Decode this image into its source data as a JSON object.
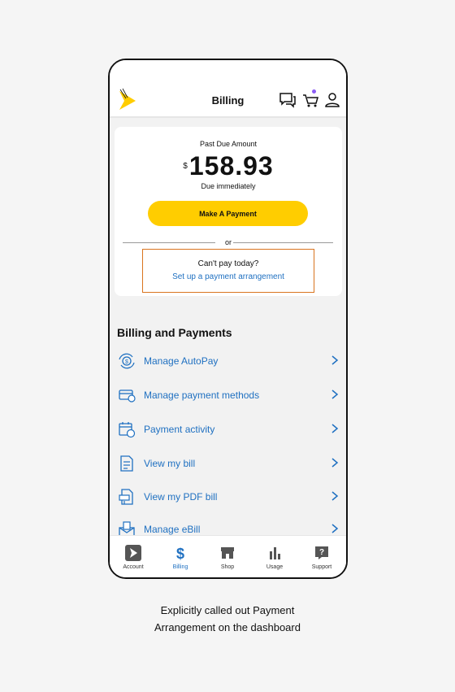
{
  "header": {
    "title": "Billing",
    "icons": [
      "chat-icon",
      "cart-icon",
      "profile-icon"
    ]
  },
  "summary": {
    "past_due_label": "Past Due Amount",
    "currency": "$",
    "amount": "158.93",
    "due_label": "Due immediately",
    "pay_button": "Make A Payment",
    "or_text": "or",
    "cant_pay": "Can't pay today?",
    "arrangement_link": "Set up a payment arrangement"
  },
  "section": {
    "title": "Billing and Payments"
  },
  "billing_items": [
    {
      "label": "Manage AutoPay",
      "icon": "autopay-icon"
    },
    {
      "label": "Manage payment methods",
      "icon": "card-icon"
    },
    {
      "label": "Payment activity",
      "icon": "calendar-dollar-icon"
    },
    {
      "label": "View my bill",
      "icon": "bill-icon"
    },
    {
      "label": "View my PDF bill",
      "icon": "pdf-icon"
    },
    {
      "label": "Manage eBill",
      "icon": "ebill-icon"
    }
  ],
  "nav": [
    {
      "label": "Account",
      "icon": "sprint-icon"
    },
    {
      "label": "Billing",
      "icon": "dollar-icon"
    },
    {
      "label": "Shop",
      "icon": "store-icon"
    },
    {
      "label": "Usage",
      "icon": "bar-chart-icon"
    },
    {
      "label": "Support",
      "icon": "question-icon"
    }
  ],
  "caption": {
    "line1": "Explicitly called out Payment",
    "line2": "Arrangement on the dashboard"
  },
  "colors": {
    "accent": "#ffcd00",
    "link": "#1f70c1",
    "highlight_border": "#d9741f",
    "cart_badge": "#8b5cf6"
  }
}
